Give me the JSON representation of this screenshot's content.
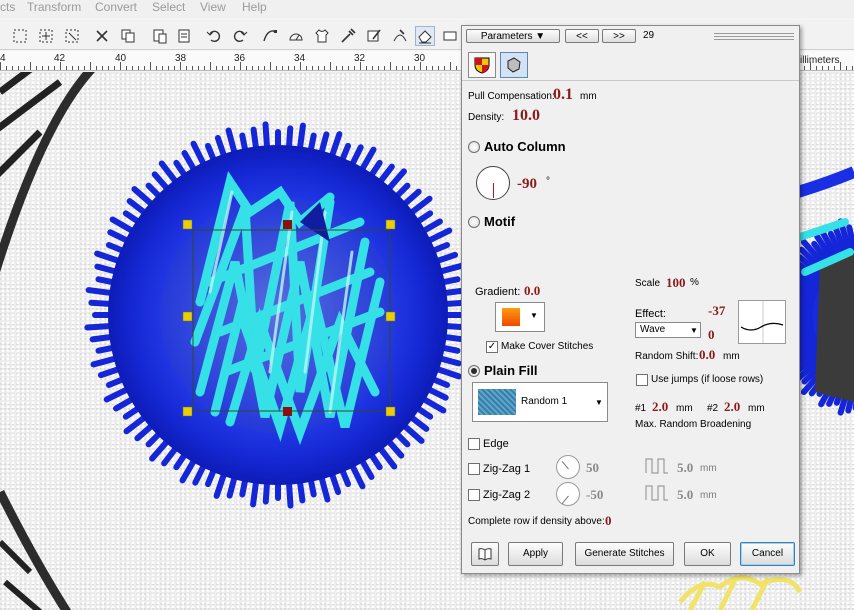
{
  "menu": {
    "items": [
      "cts",
      "Transform",
      "Convert",
      "Select",
      "View",
      "Help"
    ]
  },
  "ruler": {
    "labels": [
      "4",
      "42",
      "40",
      "38",
      "36",
      "34",
      "32",
      "30"
    ],
    "unit_label": "illimeters"
  },
  "toolbar": {
    "icons": [
      "select-rect-icon",
      "lasso-icon",
      "node-select-icon",
      "cut-icon",
      "copy-icon",
      "paste-icon",
      "undo-icon",
      "redo-icon",
      "bezier-icon",
      "gauge-icon",
      "shirt-icon",
      "eyedropper-icon",
      "stitch-edit-icon",
      "stitch-node-icon",
      "eraser-icon",
      "view-icon"
    ]
  },
  "dialog": {
    "parameters_label": "Parameters",
    "prev_label": "<<",
    "next_label": ">>",
    "object_number": "29",
    "pull_compensation": {
      "label": "Pull Compensation:",
      "value": "0.1",
      "unit": "mm"
    },
    "density": {
      "label": "Density:",
      "value": "10.0"
    },
    "auto_column": {
      "label": "Auto Column",
      "angle": "-90",
      "unit": "°"
    },
    "motif": {
      "label": "Motif"
    },
    "gradient": {
      "label": "Gradient:",
      "value": "0.0"
    },
    "scale": {
      "label": "Scale",
      "value": "100",
      "unit": "%"
    },
    "effect": {
      "label": "Effect:",
      "selected": "Wave",
      "value_top": "-37",
      "value_bottom": "0"
    },
    "make_cover_stitches": {
      "label": "Make Cover Stitches",
      "checked": true
    },
    "random_shift": {
      "label": "Random Shift:",
      "value": "0.0",
      "unit": "mm"
    },
    "plain_fill": {
      "label": "Plain Fill",
      "pattern": "Random 1"
    },
    "use_jumps": {
      "label": "Use jumps (if loose rows)",
      "checked": false
    },
    "broadening": {
      "p1_label": "#1",
      "p1_value": "2.0",
      "p1_unit": "mm",
      "p2_label": "#2",
      "p2_value": "2.0",
      "p2_unit": "mm",
      "caption": "Max. Random Broadening"
    },
    "edge": {
      "label": "Edge"
    },
    "zigzag1": {
      "label": "Zig-Zag 1",
      "angle": "50",
      "length": "5.0",
      "unit": "mm"
    },
    "zigzag2": {
      "label": "Zig-Zag 2",
      "angle": "-50",
      "length": "5.0",
      "unit": "mm"
    },
    "complete_row": {
      "label": "Complete row if density above:",
      "value": "0"
    },
    "buttons": {
      "apply": "Apply",
      "generate": "Generate Stitches",
      "ok": "OK",
      "cancel": "Cancel"
    }
  },
  "colors": {
    "value_red": "#8b1a1a",
    "annotation_blue": "#1c2dc8",
    "satin_blue": "#1426d8",
    "fill_cyan": "#35e0e6"
  }
}
